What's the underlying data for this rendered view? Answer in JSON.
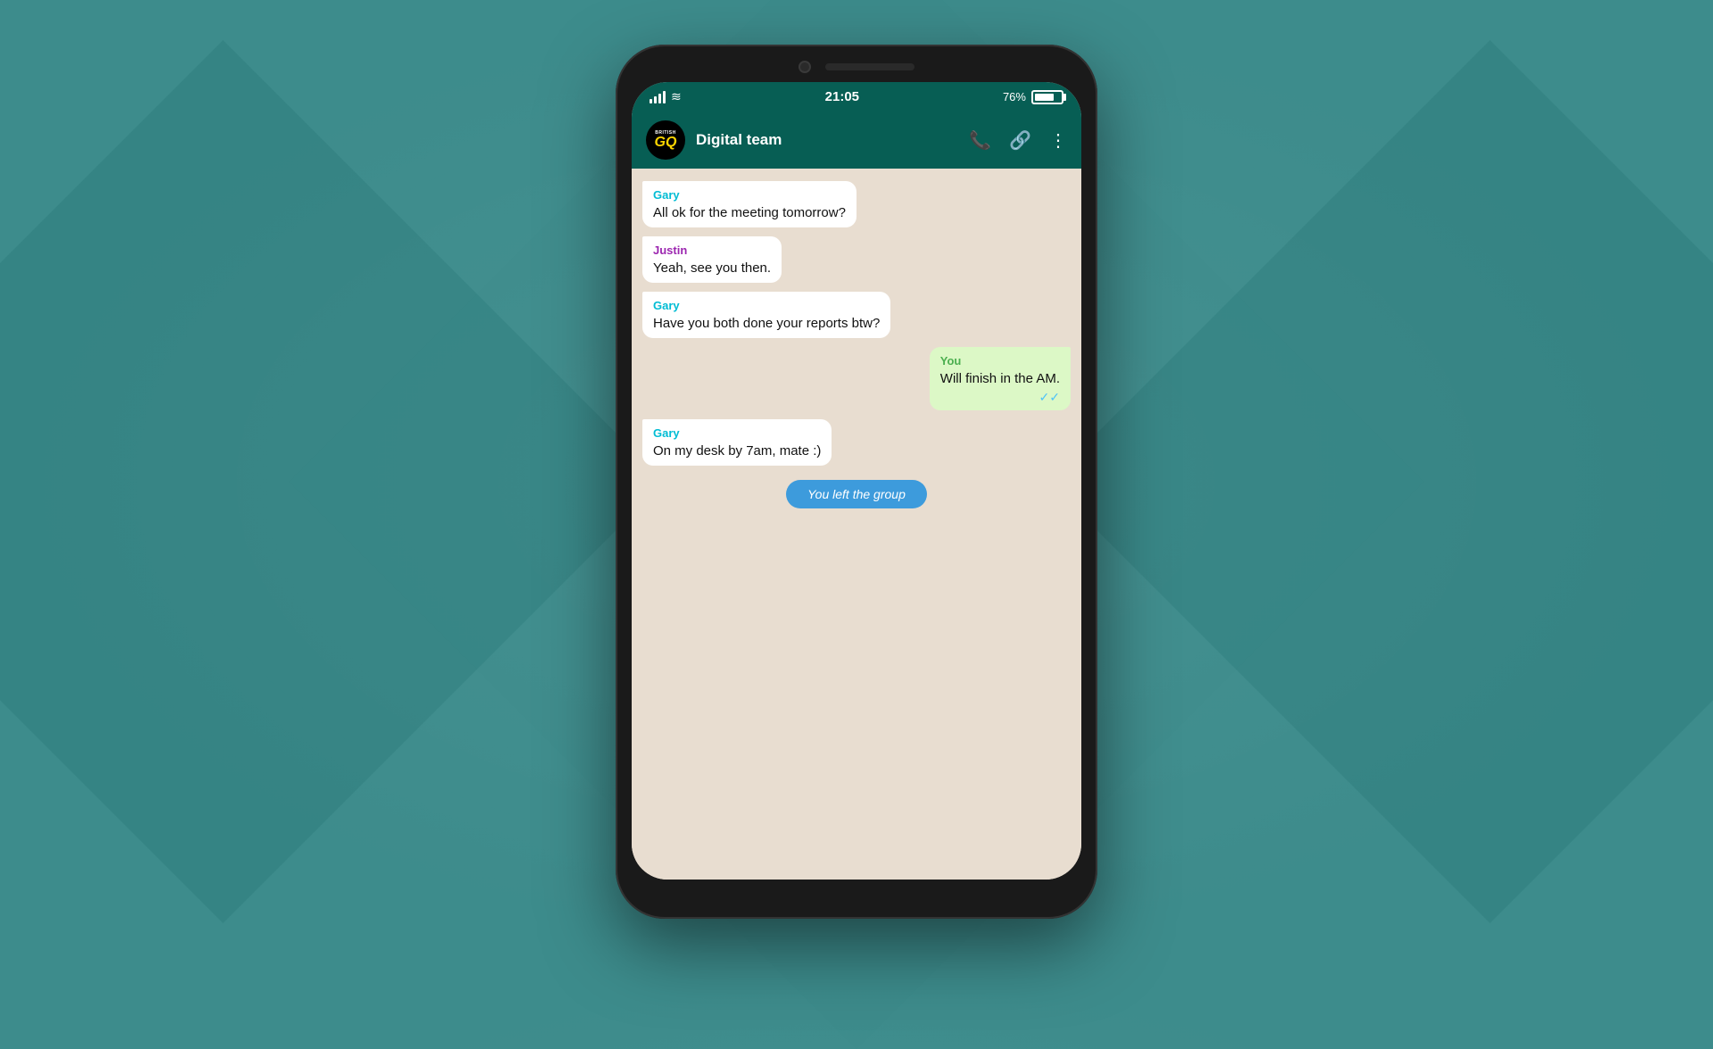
{
  "background": {
    "color": "#3d8c8c"
  },
  "phone": {
    "status_bar": {
      "time": "21:05",
      "battery_percent": "76%",
      "signal_label": "signal"
    },
    "header": {
      "group_name": "Digital team",
      "gq_british": "BRITISH",
      "gq_text": "GQ",
      "icons": {
        "phone": "📞",
        "video": "🔗",
        "more": "⋮"
      }
    },
    "messages": [
      {
        "id": "msg1",
        "type": "received",
        "sender": "Gary",
        "sender_color": "gary",
        "text": "All ok for the meeting tomorrow?"
      },
      {
        "id": "msg2",
        "type": "received",
        "sender": "Justin",
        "sender_color": "justin",
        "text": "Yeah, see you then."
      },
      {
        "id": "msg3",
        "type": "received",
        "sender": "Gary",
        "sender_color": "gary",
        "text": "Have you both done your reports btw?"
      },
      {
        "id": "msg4",
        "type": "sent",
        "sender": "You",
        "sender_color": "you",
        "text": "Will finish in the AM.",
        "read": true
      },
      {
        "id": "msg5",
        "type": "received",
        "sender": "Gary",
        "sender_color": "gary",
        "text": "On my desk by 7am, mate :)"
      }
    ],
    "system_message": {
      "text": "You left the group"
    }
  }
}
